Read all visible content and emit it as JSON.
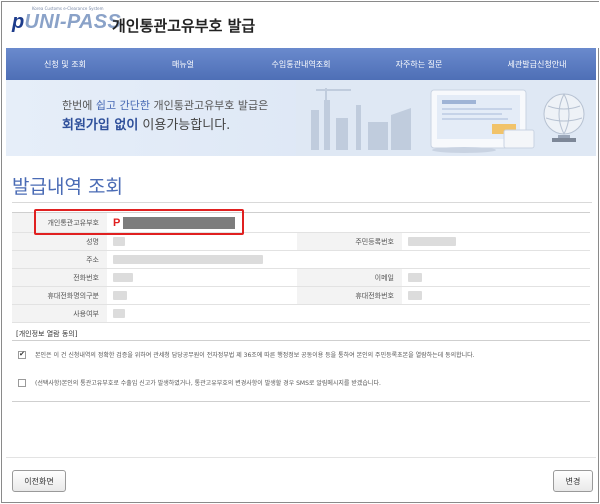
{
  "header": {
    "logo_tagline": "Korea Customs e-Clearance System",
    "logo_p": "p",
    "logo_rest": "UNI-PASS",
    "title": "개인통관고유부호 발급"
  },
  "nav": {
    "items": [
      "신청 및 조회",
      "매뉴얼",
      "수입통관내역조회",
      "자주하는 질문",
      "세관발급신청안내"
    ]
  },
  "banner": {
    "line1_a": "한번에 ",
    "line1_b": "쉽고 간단한",
    "line1_c": " 개인통관고유부호 발급은",
    "line2_a": "회원가입 없이",
    "line2_b": " 이용가능합니다."
  },
  "page": {
    "title": "발급내역 조회"
  },
  "info": {
    "pass_label": "개인통관고유부호",
    "pass_prefix": "P",
    "name_label": "성명",
    "rrn_label": "주민등록번호",
    "address_label": "주소",
    "phone_label": "전화번호",
    "email_label": "이메일",
    "mobile_owner_label": "휴대전화명의구분",
    "mobile_label": "휴대전화번호",
    "usage_label": "사용여부"
  },
  "consent": {
    "title": "[개인정보 열람 동의]",
    "item1": "본인은 이 건 신청내역의 정확한 검증을 위하여 관세청 담당공무원이 전자정부법 제 36조에 따른 행정정보 공동이용 등을 통하여 본인의 주민등록초본을 열람하는데 동의합니다.",
    "item1_checked": true,
    "item2": "(선택사항)본인의 통관고유부호로 수출입 신고가 발생하였거나, 통관고유부호의 변경사항이 발생할 경우 SMS로 알림메시지를 받겠습니다.",
    "item2_checked": false
  },
  "buttons": {
    "back": "이전화면",
    "change": "변경"
  },
  "colors": {
    "nav": "#5a7bc2",
    "accent": "#4a6bb5",
    "highlight_box": "#e02020"
  }
}
